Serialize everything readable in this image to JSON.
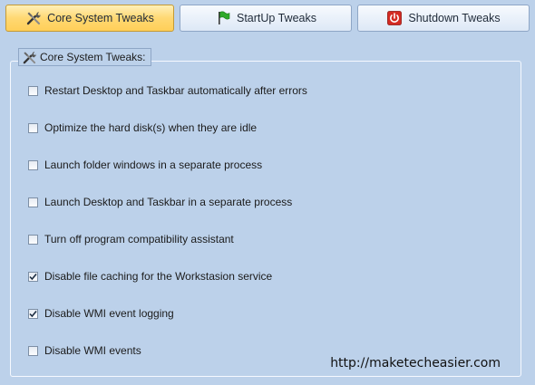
{
  "tabs": [
    {
      "label": "Core System Tweaks",
      "icon": "tools-icon",
      "active": true
    },
    {
      "label": "StartUp Tweaks",
      "icon": "green-flag-icon",
      "active": false
    },
    {
      "label": "Shutdown Tweaks",
      "icon": "power-icon",
      "active": false
    }
  ],
  "group": {
    "title": "Core System Tweaks:",
    "icon": "tools-icon"
  },
  "options": [
    {
      "label": "Restart Desktop and Taskbar automatically after errors",
      "checked": false
    },
    {
      "label": "Optimize the hard disk(s) when they are idle",
      "checked": false
    },
    {
      "label": "Launch folder windows in a separate process",
      "checked": false
    },
    {
      "label": "Launch Desktop and Taskbar in a separate process",
      "checked": false
    },
    {
      "label": "Turn off program compatibility assistant",
      "checked": false
    },
    {
      "label": "Disable file caching for the Workstasion service",
      "checked": true
    },
    {
      "label": "Disable WMI event logging",
      "checked": true
    },
    {
      "label": "Disable WMI events",
      "checked": false
    }
  ],
  "watermark": "http://maketecheasier.com",
  "colors": {
    "background": "#bcd1ea",
    "active_tab": "#ffd873",
    "group_border": "#f6f9ff"
  }
}
